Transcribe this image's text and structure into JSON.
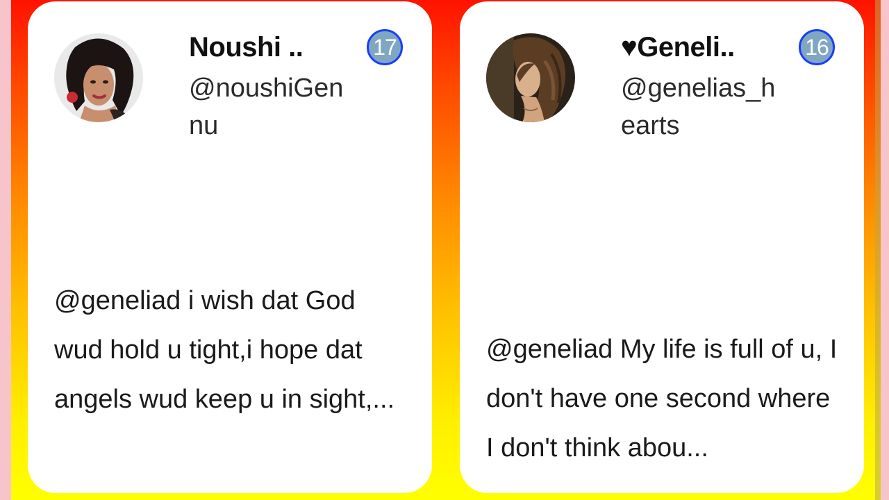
{
  "cards": [
    {
      "name": "Noushi ..",
      "handle": "@noushiGennu",
      "badge": "17",
      "tweet": "@geneliad i wish dat God wud hold u tight,i hope dat angels wud keep u in sight,...",
      "avatar_icon": "profile-photo"
    },
    {
      "name": "♥Geneli..",
      "handle": "@genelias_hearts",
      "badge": "16",
      "tweet": "@geneliad My life is full of u, I don't have one second where I don't think abou...",
      "avatar_icon": "profile-photo"
    }
  ],
  "colors": {
    "gradient_top": "#ff1200",
    "gradient_bottom": "#ffff00",
    "side_pink": "#f7c4cc",
    "badge_fill": "#7fa7c2",
    "badge_border": "#1a3cff"
  }
}
